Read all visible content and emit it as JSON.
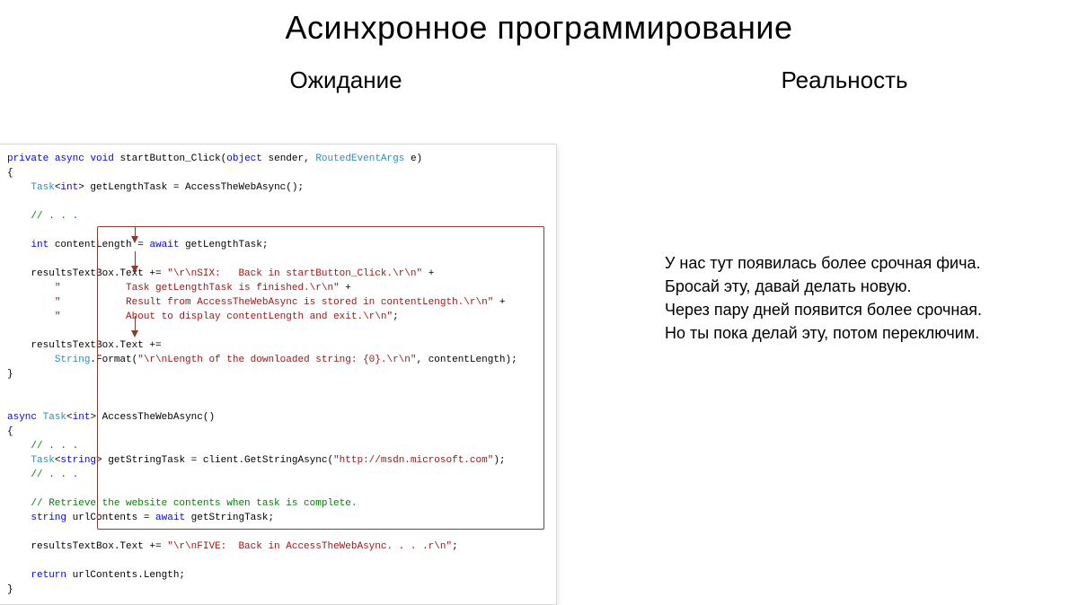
{
  "title": "Асинхронное программирование",
  "left": {
    "heading": "Ожидание",
    "code_tokens": [
      [
        "kw",
        "private"
      ],
      [
        "sp",
        " "
      ],
      [
        "kw",
        "async"
      ],
      [
        "sp",
        " "
      ],
      [
        "kw",
        "void"
      ],
      [
        "sp",
        " "
      ],
      [
        "plain",
        "startButton_Click("
      ],
      [
        "kw",
        "object"
      ],
      [
        "sp",
        " "
      ],
      [
        "plain",
        "sender, "
      ],
      [
        "type",
        "RoutedEventArgs"
      ],
      [
        "sp",
        " "
      ],
      [
        "plain",
        "e)"
      ],
      [
        "nl"
      ],
      [
        "plain",
        "{"
      ],
      [
        "nl"
      ],
      [
        "sp",
        "    "
      ],
      [
        "type",
        "Task"
      ],
      [
        "plain",
        "<"
      ],
      [
        "kw",
        "int"
      ],
      [
        "plain",
        "> getLengthTask = AccessTheWebAsync();"
      ],
      [
        "nl"
      ],
      [
        "nl"
      ],
      [
        "sp",
        "    "
      ],
      [
        "comment",
        "// . . ."
      ],
      [
        "nl"
      ],
      [
        "nl"
      ],
      [
        "sp",
        "    "
      ],
      [
        "kw",
        "int"
      ],
      [
        "sp",
        " "
      ],
      [
        "plain",
        "contentLength = "
      ],
      [
        "kw",
        "await"
      ],
      [
        "sp",
        " "
      ],
      [
        "plain",
        "getLengthTask;"
      ],
      [
        "nl"
      ],
      [
        "nl"
      ],
      [
        "sp",
        "    "
      ],
      [
        "plain",
        "resultsTextBox.Text += "
      ],
      [
        "str",
        "\"\\r\\nSIX:   Back in startButton_Click.\\r\\n\""
      ],
      [
        "sp",
        " "
      ],
      [
        "plain",
        "+"
      ],
      [
        "nl"
      ],
      [
        "sp",
        "        "
      ],
      [
        "str",
        "\"           Task getLengthTask is finished.\\r\\n\""
      ],
      [
        "sp",
        " "
      ],
      [
        "plain",
        "+"
      ],
      [
        "nl"
      ],
      [
        "sp",
        "        "
      ],
      [
        "str",
        "\"           Result from AccessTheWebAsync is stored in contentLength.\\r\\n\""
      ],
      [
        "sp",
        " "
      ],
      [
        "plain",
        "+"
      ],
      [
        "nl"
      ],
      [
        "sp",
        "        "
      ],
      [
        "str",
        "\"           About to display contentLength and exit.\\r\\n\""
      ],
      [
        "plain",
        ";"
      ],
      [
        "nl"
      ],
      [
        "nl"
      ],
      [
        "sp",
        "    "
      ],
      [
        "plain",
        "resultsTextBox.Text +="
      ],
      [
        "nl"
      ],
      [
        "sp",
        "        "
      ],
      [
        "type",
        "String"
      ],
      [
        "plain",
        ".Format("
      ],
      [
        "str",
        "\"\\r\\nLength of the downloaded string: {0}.\\r\\n\""
      ],
      [
        "plain",
        ", contentLength);"
      ],
      [
        "nl"
      ],
      [
        "plain",
        "}"
      ],
      [
        "nl"
      ],
      [
        "nl"
      ],
      [
        "nl"
      ],
      [
        "kw",
        "async"
      ],
      [
        "sp",
        " "
      ],
      [
        "type",
        "Task"
      ],
      [
        "plain",
        "<"
      ],
      [
        "kw",
        "int"
      ],
      [
        "plain",
        "> AccessTheWebAsync()"
      ],
      [
        "nl"
      ],
      [
        "plain",
        "{"
      ],
      [
        "nl"
      ],
      [
        "sp",
        "    "
      ],
      [
        "comment",
        "// . . ."
      ],
      [
        "nl"
      ],
      [
        "sp",
        "    "
      ],
      [
        "type",
        "Task"
      ],
      [
        "plain",
        "<"
      ],
      [
        "kw",
        "string"
      ],
      [
        "plain",
        "> getStringTask = client.GetStringAsync("
      ],
      [
        "str",
        "\"http://msdn.microsoft.com\""
      ],
      [
        "plain",
        ");"
      ],
      [
        "nl"
      ],
      [
        "sp",
        "    "
      ],
      [
        "comment",
        "// . . ."
      ],
      [
        "nl"
      ],
      [
        "nl"
      ],
      [
        "sp",
        "    "
      ],
      [
        "comment",
        "// Retrieve the website contents when task is complete."
      ],
      [
        "nl"
      ],
      [
        "sp",
        "    "
      ],
      [
        "kw",
        "string"
      ],
      [
        "sp",
        " "
      ],
      [
        "plain",
        "urlContents = "
      ],
      [
        "kw",
        "await"
      ],
      [
        "sp",
        " "
      ],
      [
        "plain",
        "getStringTask;"
      ],
      [
        "nl"
      ],
      [
        "nl"
      ],
      [
        "sp",
        "    "
      ],
      [
        "plain",
        "resultsTextBox.Text += "
      ],
      [
        "str",
        "\"\\r\\nFIVE:  Back in AccessTheWebAsync. . . .r\\n\""
      ],
      [
        "plain",
        ";"
      ],
      [
        "nl"
      ],
      [
        "nl"
      ],
      [
        "sp",
        "    "
      ],
      [
        "kw",
        "return"
      ],
      [
        "sp",
        " "
      ],
      [
        "plain",
        "urlContents.Length;"
      ],
      [
        "nl"
      ],
      [
        "plain",
        "}"
      ]
    ]
  },
  "right": {
    "heading": "Реальность",
    "body": [
      "У нас тут появилась более срочная фича.",
      "Бросай эту, давай делать новую.",
      "Через пару дней появится более срочная.",
      "Но ты пока делай эту, потом переключим."
    ]
  }
}
